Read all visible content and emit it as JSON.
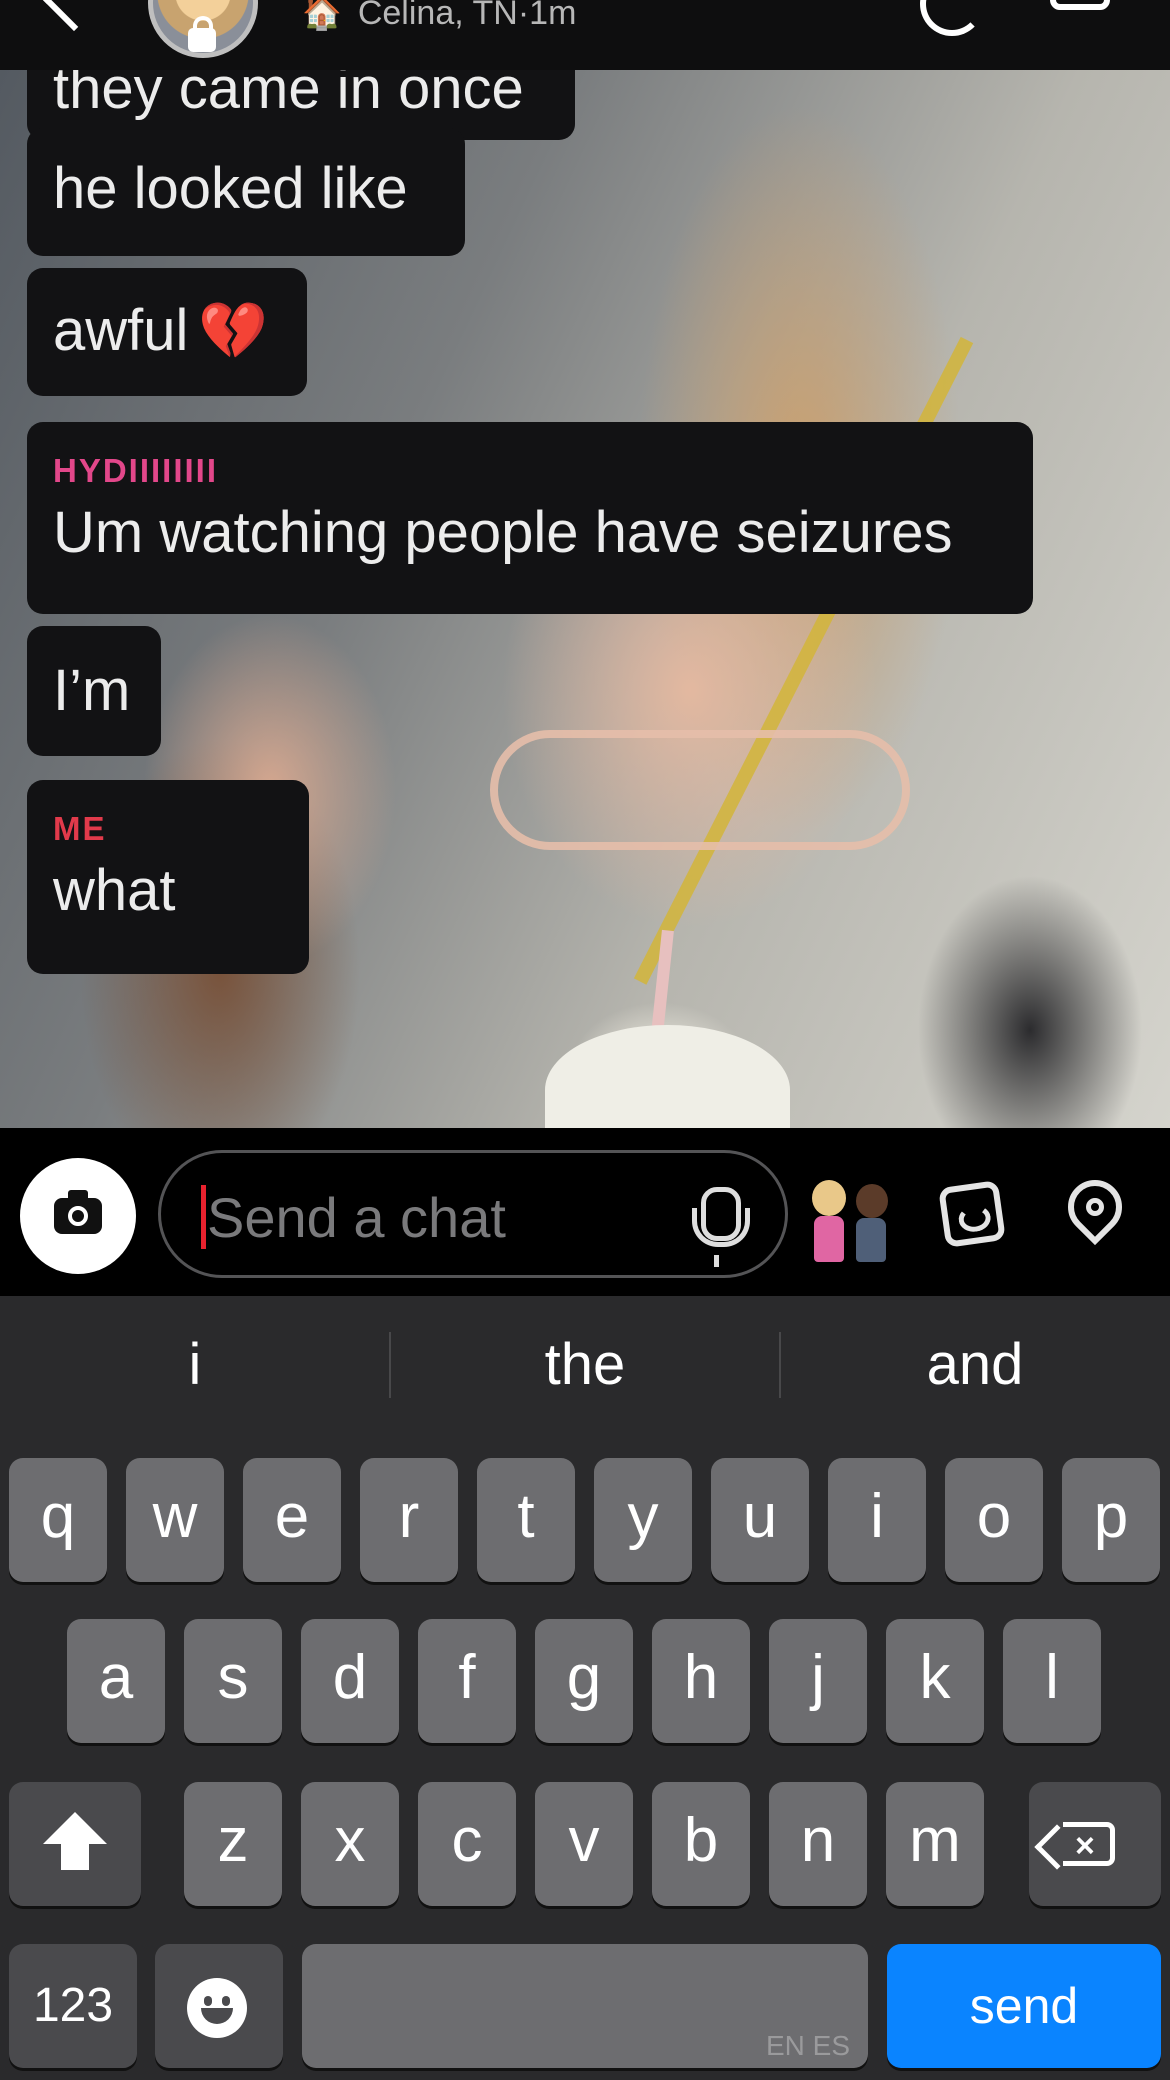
{
  "header": {
    "location": "Celina, TN",
    "time": "1m",
    "separator": " · ",
    "house_emoji": "🏠"
  },
  "messages": [
    {
      "sender": "",
      "text": "they came in once"
    },
    {
      "sender": "",
      "text": "he looked like"
    },
    {
      "sender": "",
      "text": "awful",
      "emoji": "💔"
    },
    {
      "sender": "HYDIIIIIIII",
      "sender_color": "#e2478a",
      "text": "Um watching people have seizures"
    },
    {
      "sender": "",
      "text": "I’m"
    },
    {
      "sender": "ME",
      "sender_color": "#e23a4b",
      "text": "what"
    }
  ],
  "composer": {
    "placeholder": "Send a chat",
    "icons": [
      "camera-icon",
      "microphone-icon",
      "bitmoji-icon",
      "sticker-icon",
      "location-pin-icon"
    ]
  },
  "keyboard": {
    "suggestions": [
      "i",
      "the",
      "and"
    ],
    "row1": [
      "q",
      "w",
      "e",
      "r",
      "t",
      "y",
      "u",
      "i",
      "o",
      "p"
    ],
    "row2": [
      "a",
      "s",
      "d",
      "f",
      "g",
      "h",
      "j",
      "k",
      "l"
    ],
    "row3": [
      "z",
      "x",
      "c",
      "v",
      "b",
      "n",
      "m"
    ],
    "numbers_label": "123",
    "send_label": "send",
    "languages": "EN ES",
    "send_color": "#0a84ff"
  }
}
